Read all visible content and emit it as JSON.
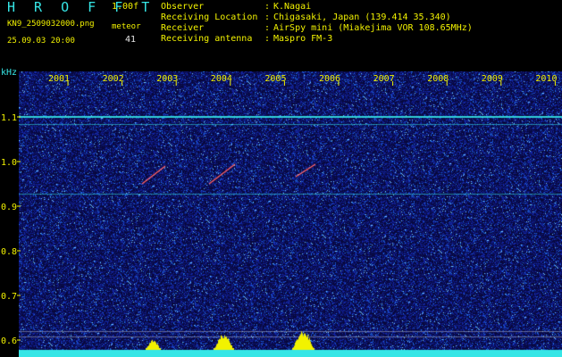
{
  "header": {
    "brand": "H R O F F T",
    "version": "1.00f",
    "filename": "KN9_2509032000.png",
    "meteor_label": "meteor",
    "meteor_count": "41",
    "timestamp": "25.09.03 20:00",
    "meta": [
      {
        "label": "Observer",
        "colon": ":",
        "value": "K.Nagai"
      },
      {
        "label": "Receiving Location",
        "colon": ":",
        "value": "Chigasaki, Japan (139.414 35.340)"
      },
      {
        "label": "Receiver",
        "colon": ":",
        "value": "AirSpy mini (Miakejima VOR 108.65MHz)"
      },
      {
        "label": "Receiving antenna",
        "colon": ":",
        "value": "Maspro FM-3"
      }
    ]
  },
  "plot": {
    "y_unit": "kHz",
    "y_ticks": [
      "1.1",
      "1.0",
      "0.9",
      "0.8",
      "0.7",
      "0.6"
    ],
    "x_ticks": [
      "2001",
      "2002",
      "2003",
      "2004",
      "2005",
      "2006",
      "2007",
      "2008",
      "2009",
      "2010"
    ],
    "colors": {
      "background": "#000000",
      "noise_dark": "#0a0a5a",
      "tick_label": "#f2f200",
      "axis_label": "#36e6e6",
      "carrier": "#36e6e6",
      "echo": "#ff2a2a",
      "activity": "#f2f200",
      "baseline": "#36e6e6"
    }
  }
}
